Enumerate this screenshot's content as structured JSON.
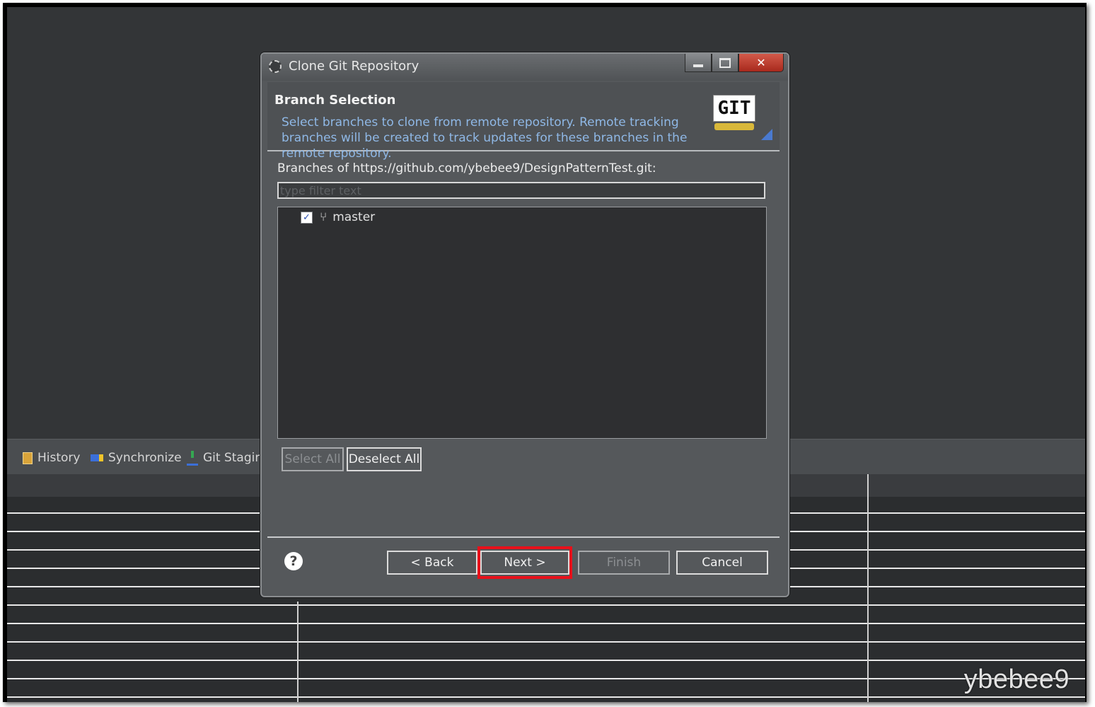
{
  "dialog": {
    "title": "Clone Git Repository",
    "header_title": "Branch Selection",
    "header_description": "Select branches to clone from remote repository. Remote tracking branches will be created to track updates for these branches in the remote repository.",
    "logo_text": "GIT",
    "branches_label": "Branches of https://github.com/ybebee9/DesignPatternTest.git:",
    "filter_placeholder": "type filter text",
    "branches": [
      {
        "name": "master",
        "checked": true
      }
    ],
    "buttons": {
      "select_all": "Select All",
      "deselect_all": "Deselect All",
      "back": "< Back",
      "next": "Next >",
      "finish": "Finish",
      "cancel": "Cancel"
    },
    "highlight_color": "#e8101a"
  },
  "view_tabs": [
    {
      "label": "History",
      "icon": "history-icon"
    },
    {
      "label": "Synchronize",
      "icon": "synchronize-icon"
    },
    {
      "label": "Git Staging",
      "icon": "git-staging-icon"
    }
  ],
  "watermark": "ybebee9"
}
